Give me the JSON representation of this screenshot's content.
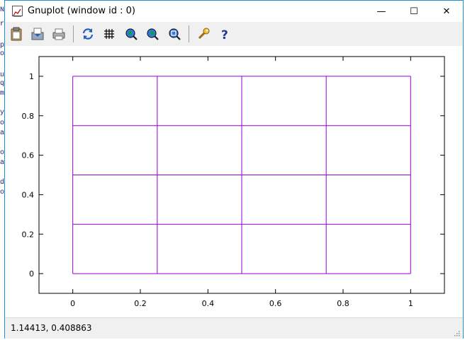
{
  "window": {
    "title": "Gnuplot (window id : 0)",
    "minimize_glyph": "—",
    "maximize_glyph": "☐",
    "close_glyph": "✕"
  },
  "background_letters": [
    "N",
    "r",
    "p",
    "o",
    "u",
    "q",
    "m",
    "y",
    "o",
    "a",
    "o",
    "a",
    "d",
    "o"
  ],
  "toolbar": {
    "buttons": [
      {
        "name": "copy-to-clipboard-icon"
      },
      {
        "name": "save-icon"
      },
      {
        "name": "print-icon"
      },
      {
        "name": "replot-icon"
      },
      {
        "name": "grid-icon"
      },
      {
        "name": "zoom-previous-icon"
      },
      {
        "name": "zoom-next-icon"
      },
      {
        "name": "unzoom-icon"
      },
      {
        "name": "options-wrench-icon"
      },
      {
        "name": "help-icon"
      }
    ]
  },
  "status": {
    "coordinates": "1.14413,  0.408863"
  },
  "chart_data": {
    "type": "line",
    "title": "",
    "xlabel": "",
    "ylabel": "",
    "xlim": [
      -0.1,
      1.1
    ],
    "ylim": [
      -0.1,
      1.1
    ],
    "x_ticks": [
      0,
      0.2,
      0.4,
      0.6,
      0.8,
      1
    ],
    "x_tick_labels": [
      "0",
      "0.2",
      "0.4",
      "0.6",
      "0.8",
      "1"
    ],
    "y_ticks": [
      0,
      0.2,
      0.4,
      0.6,
      0.8,
      1
    ],
    "y_tick_labels": [
      "0",
      "0.2",
      "0.4",
      "0.6",
      "0.8",
      "1"
    ],
    "grid": false,
    "line_color": "#9400d3",
    "series": [
      {
        "values": [
          [
            0,
            0
          ],
          [
            1,
            0
          ]
        ]
      },
      {
        "values": [
          [
            0,
            0.25
          ],
          [
            1,
            0.25
          ]
        ]
      },
      {
        "values": [
          [
            0,
            0.5
          ],
          [
            1,
            0.5
          ]
        ]
      },
      {
        "values": [
          [
            0,
            0.75
          ],
          [
            1,
            0.75
          ]
        ]
      },
      {
        "values": [
          [
            0,
            1
          ],
          [
            1,
            1
          ]
        ]
      },
      {
        "values": [
          [
            0,
            0
          ],
          [
            0,
            1
          ]
        ]
      },
      {
        "values": [
          [
            0.25,
            0
          ],
          [
            0.25,
            1
          ]
        ]
      },
      {
        "values": [
          [
            0.5,
            0
          ],
          [
            0.5,
            1
          ]
        ]
      },
      {
        "values": [
          [
            0.75,
            0
          ],
          [
            0.75,
            1
          ]
        ]
      },
      {
        "values": [
          [
            1,
            0
          ],
          [
            1,
            1
          ]
        ]
      }
    ]
  }
}
